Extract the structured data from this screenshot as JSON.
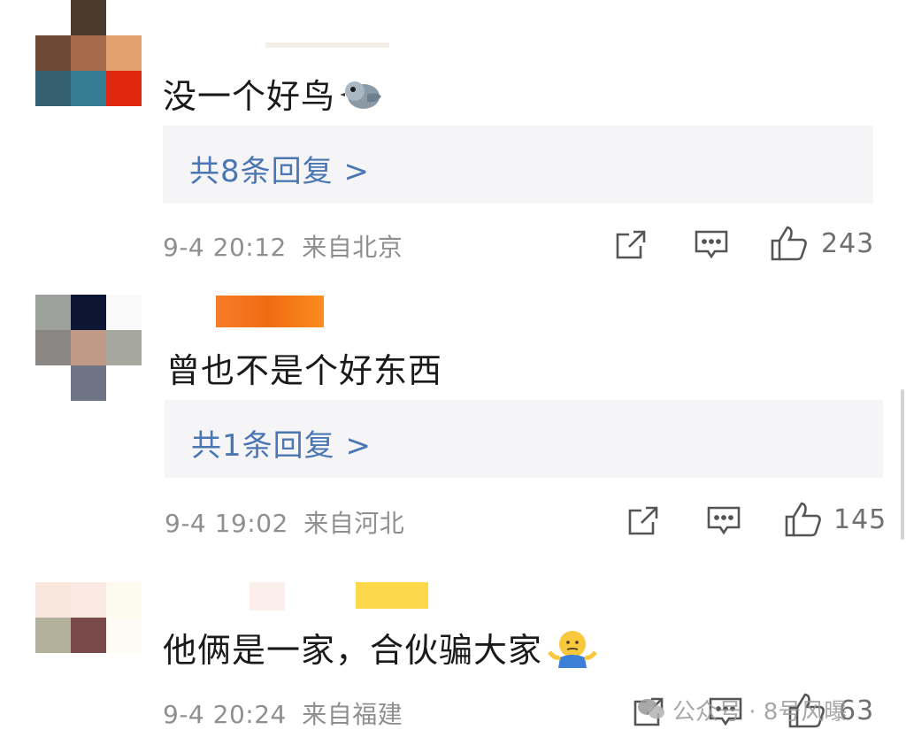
{
  "comments": [
    {
      "text": "没一个好鸟",
      "emoji": "bird-emoji",
      "reply_label": "共8条回复 >",
      "date_time": "9-4 20:12",
      "location": "来自北京",
      "likes": "243",
      "avatar_colors": [
        "#ffffff",
        "#4b3a2e",
        "#ffffff",
        "#6e4a34",
        "#a56b4b",
        "#e3a170",
        "#346070",
        "#347c92",
        "#e0280f"
      ],
      "nickname_color": ""
    },
    {
      "text": "曾也不是个好东西",
      "emoji": "",
      "reply_label": "共1条回复 >",
      "date_time": "9-4 19:02",
      "location": "来自河北",
      "likes": "145",
      "avatar_colors": [
        "#9ca19c",
        "#0c1634",
        "#fafafa",
        "#8b8784",
        "#c09a86",
        "#a6a89d",
        "#ffffff",
        "#6e7486",
        "#ffffff"
      ],
      "nickname_color": "#f27a1e"
    },
    {
      "text": "他俩是一家，合伙骗大家",
      "emoji": "shrug-emoji",
      "reply_label": "",
      "date_time": "9-4 20:24",
      "location": "来自福建",
      "likes": "63",
      "avatar_colors": [
        "#f9e6dc",
        "#faeae2",
        "#fcfbee",
        "#b3b09c",
        "#7a4a4a",
        "#fcfbf4",
        "#ffffff",
        "#ffffff",
        "#ffffff"
      ],
      "nickname_color": "#fcd84a"
    }
  ],
  "watermark": "公众号 · 8号风曝"
}
